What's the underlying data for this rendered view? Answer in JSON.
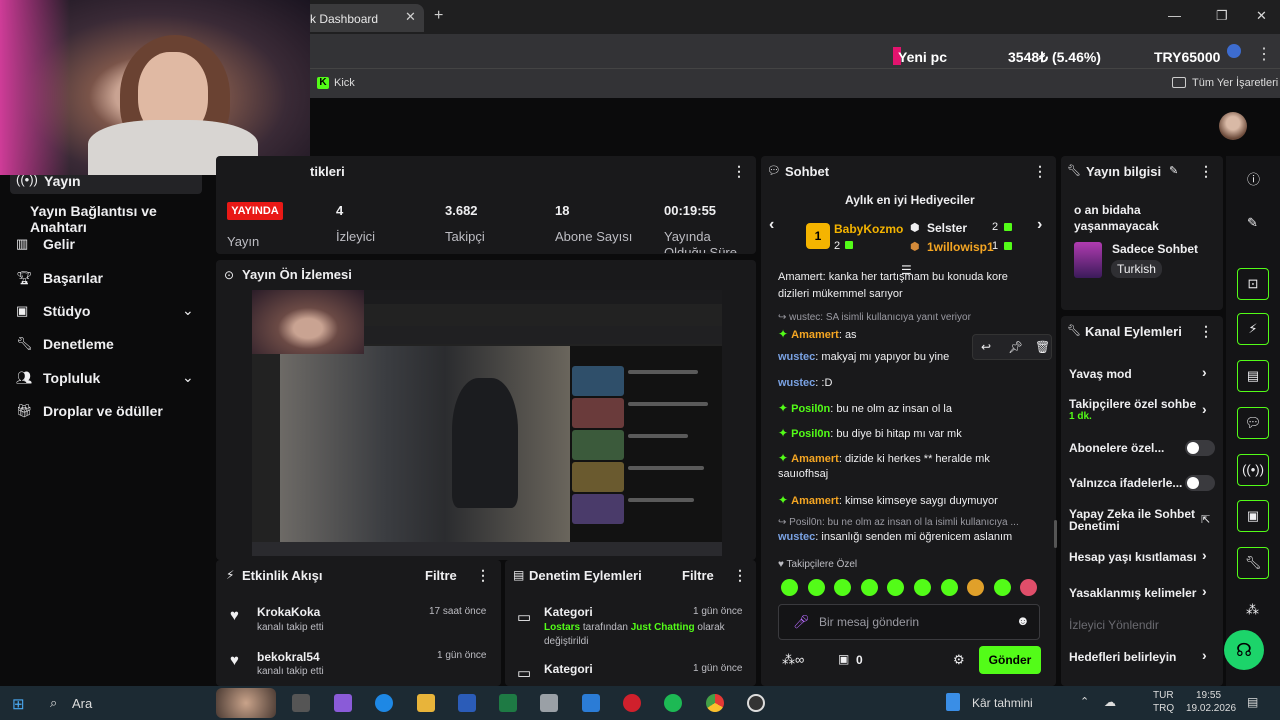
{
  "browser": {
    "tab_title": "k Dashboard",
    "bookmark": "Kick",
    "bookmarks_folder": "Tüm Yer İşaretleri",
    "ticker": {
      "name": "Yeni pc",
      "value": "3548₺ (5.46%)",
      "currency": "TRY65000"
    }
  },
  "sidebar": {
    "items": [
      {
        "label": "Yayın",
        "icon": "broadcast-icon"
      },
      {
        "label": "Yayın Bağlantısı ve Anahtarı"
      },
      {
        "label": "Gelir",
        "icon": "chart-icon"
      },
      {
        "label": "Başarılar",
        "icon": "trophy-icon"
      },
      {
        "label": "Stüdyo",
        "icon": "studio-icon",
        "expandable": true
      },
      {
        "label": "Denetleme",
        "icon": "wrench-icon"
      },
      {
        "label": "Topluluk",
        "icon": "people-icon",
        "expandable": true
      },
      {
        "label": "Droplar ve ödüller",
        "icon": "gift-icon"
      }
    ]
  },
  "stats": {
    "title_fragment": "tikleri",
    "live_badge": "YAYINDA",
    "live_label": "Yayın",
    "items": [
      {
        "value": "4",
        "label": "İzleyici"
      },
      {
        "value": "3.682",
        "label": "Takipçi"
      },
      {
        "value": "18",
        "label": "Abone Sayısı"
      },
      {
        "value": "00:19:55",
        "label": "Yayında Olduğu Süre"
      }
    ]
  },
  "preview": {
    "title": "Yayın Ön İzlemesi"
  },
  "activity": {
    "title": "Etkinlik Akışı",
    "filter": "Filtre",
    "events": [
      {
        "user": "KrokaKoka",
        "action": "kanalı takip etti",
        "time": "17 saat önce"
      },
      {
        "user": "bekokral54",
        "action": "kanalı takip etti",
        "time": "1 gün önce"
      }
    ]
  },
  "moderation": {
    "title": "Denetim Eylemleri",
    "filter": "Filtre",
    "events": [
      {
        "title": "Kategori",
        "time": "1 gün önce",
        "actor": "Lostars",
        "mid": "tarafından",
        "target": "Just Chatting",
        "suffix": "olarak",
        "line2": "değiştirildi"
      },
      {
        "title": "Kategori",
        "time": "1 gün önce"
      }
    ]
  },
  "chat": {
    "title": "Sohbet",
    "gifters_title": "Aylık en iyi Hediyeciler",
    "gifters": [
      {
        "rank": "1",
        "name": "BabyKozmo",
        "count": "2"
      },
      {
        "name": "Selster",
        "count": "2"
      },
      {
        "name": "1willowisp1",
        "count": "1"
      }
    ],
    "top_fragment": "Amamert: kanka her tartışmam bu konuda kore",
    "top_fragment_2": "dizileri mükemmel sarıyor",
    "messages": [
      {
        "reply": "wustec: SA isimli kullanıcıya yanıt veriyor"
      },
      {
        "user": "Amamert",
        "text": "as",
        "gem": true,
        "color": "#f5a623"
      },
      {
        "user": "wustec",
        "text": "makyaj mı yapıyor bu yine",
        "color": "#7aa2e3"
      },
      {
        "user": "wustec",
        "text": ":D",
        "color": "#7aa2e3"
      },
      {
        "user": "Posil0n",
        "text": "bu ne olm az insan ol la",
        "gem": true,
        "color": "#53fc18"
      },
      {
        "user": "Posil0n",
        "text": "bu diye bi hitap mı var mk",
        "gem": true,
        "color": "#53fc18"
      },
      {
        "user": "Amamert",
        "text": "dizide ki herkes ** heralde mk",
        "text2": "sauıofhsaj",
        "gem": true,
        "color": "#f5a623"
      },
      {
        "user": "Amamert",
        "text": "kimse kimseye saygı duymuyor",
        "gem": true,
        "color": "#f5a623"
      },
      {
        "reply": "Posil0n: bu ne olm az insan ol la isimli kullanıcıya ..."
      },
      {
        "user": "wustec",
        "text": "insanlığı senden mi öğrenicem aslanım",
        "color": "#7aa2e3"
      }
    ],
    "followers_only": "Takipçilere Özel",
    "placeholder": "Bir mesaj gönderin",
    "points": "0",
    "send": "Gönder"
  },
  "stream_info": {
    "title": "Yayın bilgisi",
    "stream_title_1": "o an bidaha",
    "stream_title_2": "yaşanmayacak",
    "category": "Sadece Sohbet",
    "tag": "Turkish"
  },
  "channel_actions": {
    "title": "Kanal Eylemleri",
    "rows": [
      {
        "label": "Yavaş mod",
        "type": "arrow"
      },
      {
        "label": "Takipçilere özel sohbe",
        "sub": "1 dk.",
        "type": "arrow"
      },
      {
        "label": "Abonelere özel...",
        "type": "toggle"
      },
      {
        "label": "Yalnızca ifadelerle...",
        "type": "toggle"
      },
      {
        "label": "Yapay Zeka ile Sohbet",
        "label2": "Denetimi",
        "type": "external"
      },
      {
        "label": "Hesap yaşı kısıtlaması",
        "type": "arrow"
      },
      {
        "label": "Yasaklanmış kelimeler",
        "type": "arrow"
      },
      {
        "label": "İzleyici Yönlendir",
        "type": "disabled"
      },
      {
        "label": "Hedefleri belirleyin",
        "type": "arrow"
      }
    ]
  },
  "taskbar": {
    "search": "Ara",
    "weather": "Kâr tahmini",
    "lang": "TUR",
    "lang2": "TRQ",
    "time": "19:55",
    "date": "19.02.2026"
  },
  "colors": {
    "accent": "#53fc18",
    "live": "#e91916",
    "panel": "#19191b"
  }
}
